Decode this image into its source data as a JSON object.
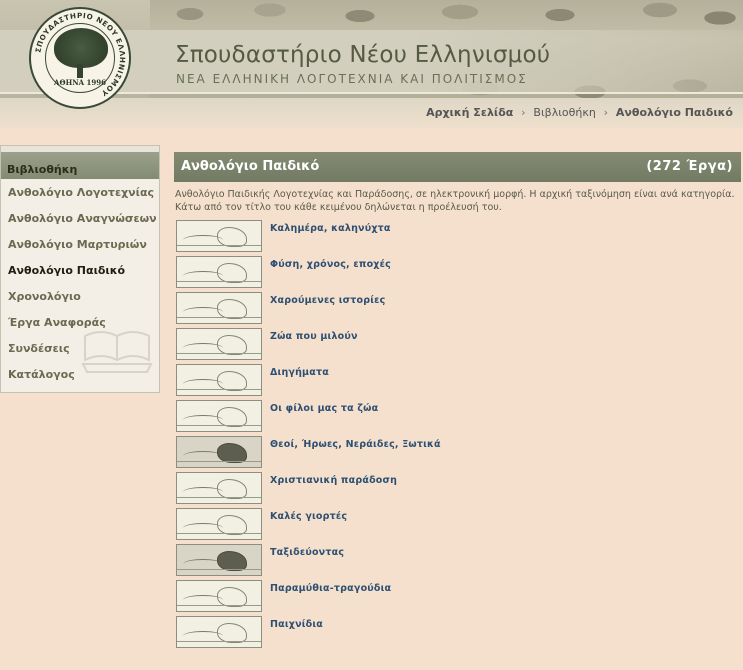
{
  "header": {
    "title": "Σπουδαστήριο Νέου Ελληνισμού",
    "subtitle": "ΝΕΑ ΕΛΛΗΝΙΚΗ ΛΟΓΟΤΕΧΝΙΑ ΚΑΙ ΠΟΛΙΤΙΣΜΟΣ",
    "logo_ring_text": "ΣΠΟΥΔΑΣΤΗΡΙΟ ΝΕΟΥ ΕΛΛΗΝΙΣΜΟΥ",
    "logo_year_text": "ΑΘΗΝΑ 1996"
  },
  "breadcrumb": {
    "home": "Αρχική Σελίδα",
    "library": "Βιβλιοθήκη",
    "current": "Ανθολόγιο Παιδικό",
    "separator": "›"
  },
  "sidebar": {
    "heading": "Βιβλιοθήκη",
    "items": [
      {
        "label": "Ανθολόγιο Λογοτεχνίας",
        "active": false
      },
      {
        "label": "Ανθολόγιο Αναγνώσεων",
        "active": false
      },
      {
        "label": "Ανθολόγιο Μαρτυριών",
        "active": false
      },
      {
        "label": "Ανθολόγιο Παιδικό",
        "active": true
      },
      {
        "label": "Χρονολόγιο",
        "active": false
      },
      {
        "label": "Έργα Αναφοράς",
        "active": false
      },
      {
        "label": "Συνδέσεις",
        "active": false
      },
      {
        "label": "Κατάλογος",
        "active": false
      }
    ]
  },
  "main": {
    "title": "Ανθολόγιο Παιδικό",
    "count": "(272 Έργα)",
    "intro": "Ανθολόγιο Παιδικής Λογοτεχνίας και Παράδοσης, σε ηλεκτρονική μορφή. Η αρχική ταξινόμηση είναι ανά κατηγορία. Κάτω από τον τίτλο του κάθε κειμένου δηλώνεται η προέλευσή του.",
    "categories": [
      {
        "label": "Καλημέρα, καληνύχτα",
        "icon": "sunrise-sketch-thumbnail"
      },
      {
        "label": "Φύση, χρόνος, εποχές",
        "icon": "landscape-sketch-thumbnail"
      },
      {
        "label": "Χαρούμενες ιστορίες",
        "icon": "children-sketch-thumbnail"
      },
      {
        "label": "Ζώα που μιλούν",
        "icon": "bird-sketch-thumbnail"
      },
      {
        "label": "Διηγήματα",
        "icon": "village-sketch-thumbnail"
      },
      {
        "label": "Οι φίλοι μας τα ζώα",
        "icon": "animal-sketch-thumbnail"
      },
      {
        "label": "Θεοί, Ήρωες, Νεράιδες, Ξωτικά",
        "icon": "hero-sketch-thumbnail"
      },
      {
        "label": "Χριστιανική παράδοση",
        "icon": "icon-sketch-thumbnail"
      },
      {
        "label": "Καλές γιορτές",
        "icon": "church-sketch-thumbnail"
      },
      {
        "label": "Ταξιδεύοντας",
        "icon": "boat-sketch-thumbnail"
      },
      {
        "label": "Παραμύθια-τραγούδια",
        "icon": "fairytale-sketch-thumbnail"
      },
      {
        "label": "Παιχνίδια",
        "icon": "games-sketch-thumbnail"
      }
    ]
  },
  "colors": {
    "background": "#f4e0cd",
    "header_bar": "#848b73",
    "link": "#2d4f72",
    "title_text": "#555a44"
  }
}
